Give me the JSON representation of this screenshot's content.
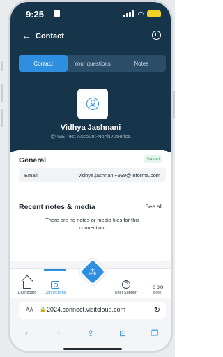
{
  "status_bar": {
    "time": "9:25"
  },
  "header": {
    "back_icon": "←",
    "title": "Contact",
    "history_icon": "clock-icon"
  },
  "tabs": [
    {
      "label": "Contact",
      "active": true
    },
    {
      "label": "Your questions",
      "active": false
    },
    {
      "label": "Notes",
      "active": false
    }
  ],
  "profile": {
    "name": "Vidhya Jashnani",
    "org": "@ GE Test Account-North America"
  },
  "general": {
    "title": "General",
    "saved_badge": "Saved",
    "email_label": "Email",
    "email_value": "vidhya.jashnani+999@informa.com"
  },
  "recent": {
    "title": "Recent notes & media",
    "see_all": "See all",
    "empty_message": "There are no notes or media files for this connection."
  },
  "bottom_nav": [
    {
      "label": "Dashboard",
      "icon": "home-icon",
      "active": false
    },
    {
      "label": "Connections",
      "icon": "contacts-icon",
      "active": true
    },
    {
      "label": "User Support",
      "icon": "support-icon",
      "active": false
    },
    {
      "label": "More",
      "icon": "more-icon",
      "active": false
    }
  ],
  "browser": {
    "aa": "AA",
    "url": "2024.connect.visitcloud.com",
    "reload_icon": "↻"
  },
  "colors": {
    "header_bg": "#17354a",
    "accent": "#2e8fe0",
    "saved": "#2fa85c"
  }
}
